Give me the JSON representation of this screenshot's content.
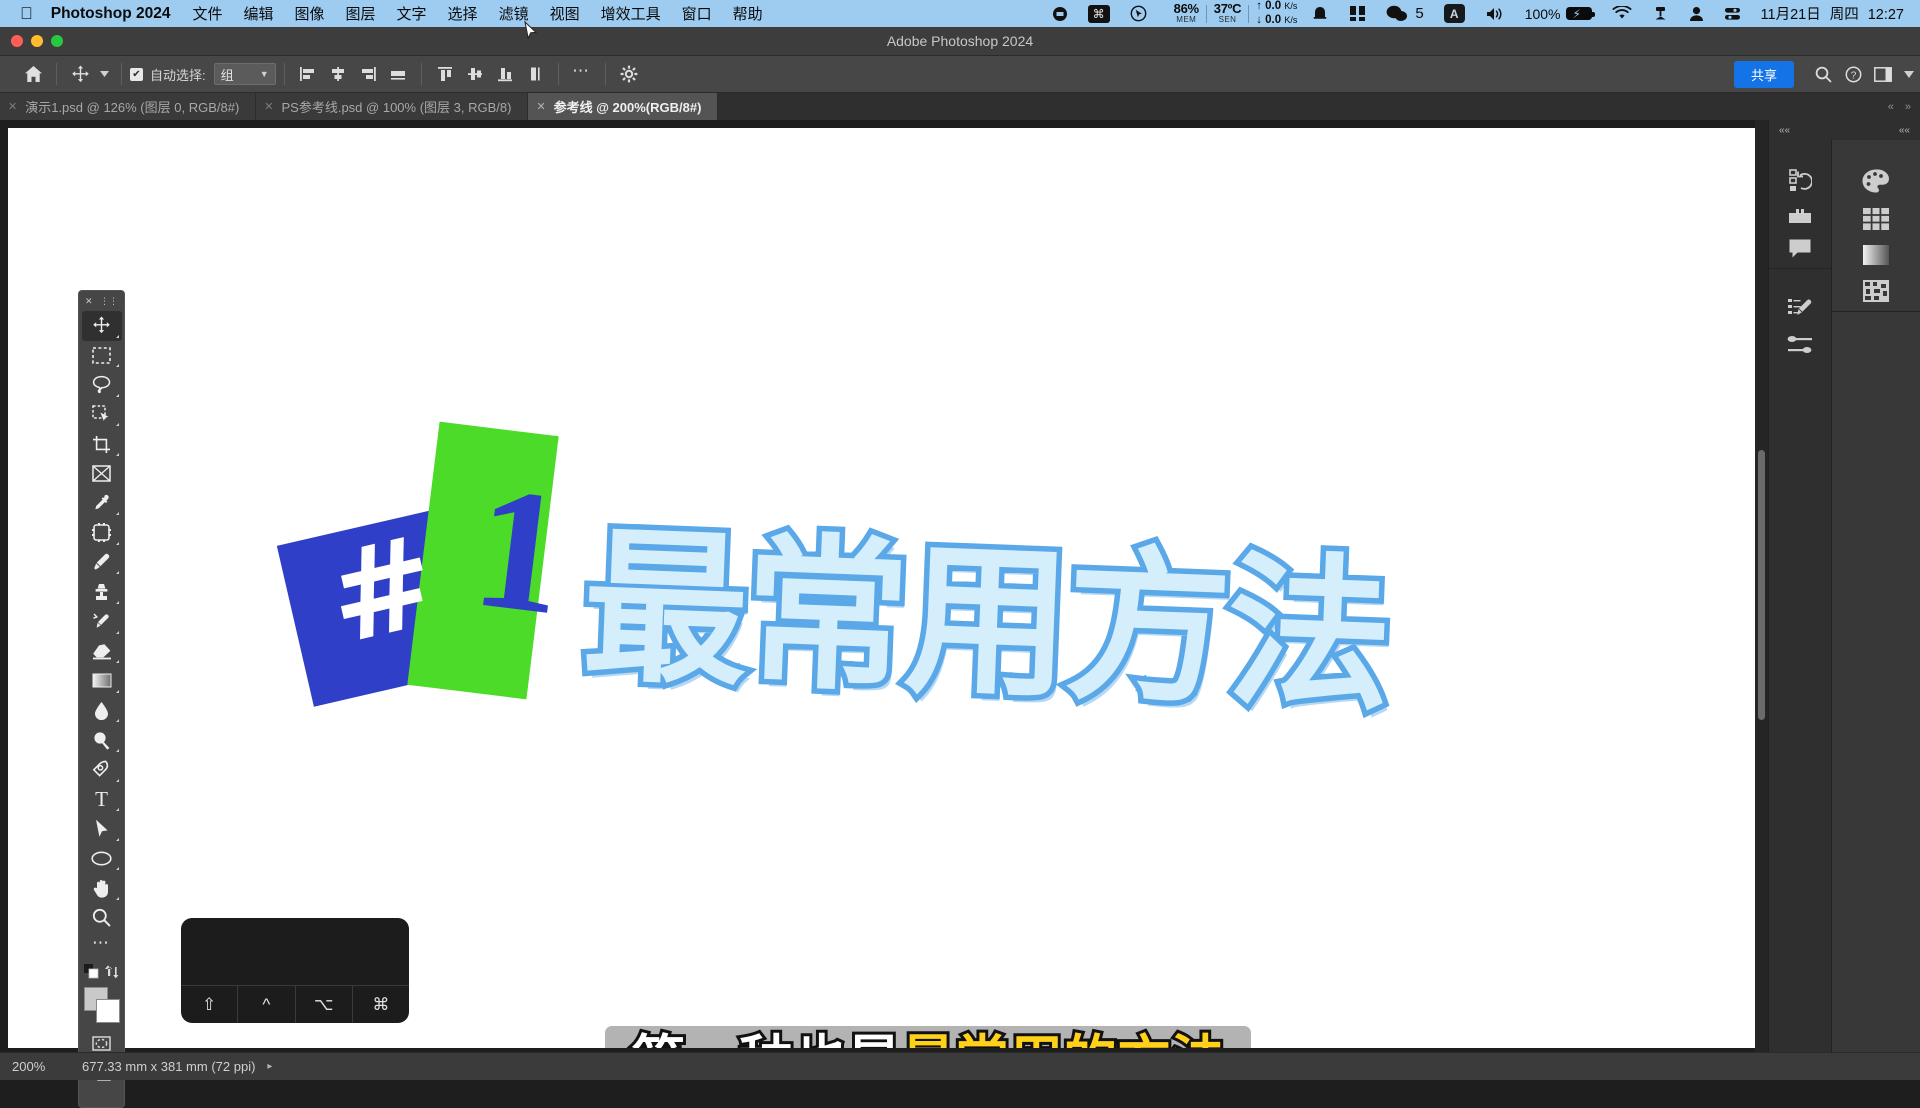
{
  "menubar": {
    "apple_icon": "apple-logo-icon",
    "app_name": "Photoshop 2024",
    "menus": [
      "文件",
      "编辑",
      "图像",
      "图层",
      "文字",
      "选择",
      "滤镜",
      "视图",
      "增效工具",
      "窗口",
      "帮助"
    ],
    "tray": {
      "record_icon": "record-dot-icon",
      "command_badge": "⌘",
      "cursor_icon": "cursor-circle-icon",
      "memory_value": "86%",
      "memory_label": "MEM",
      "temp_value": "37ºC",
      "temp_label": "SEN",
      "net_up": "0.0",
      "net_up_unit": "K/s",
      "net_down": "0.0",
      "net_down_unit": "K/s",
      "bell_icon": "bell-icon",
      "grid_icon": "grid-apps-icon",
      "wechat_icon": "wechat-icon",
      "wechat_count": "5",
      "input_method": "A",
      "volume_icon": "volume-icon",
      "battery_percent": "100%",
      "battery_icon": "battery-charging-icon",
      "wifi_icon": "wifi-icon",
      "screen_icon": "airplay-icon",
      "user_icon": "user-icon",
      "controlcenter_icon": "control-center-icon",
      "date": "11月21日",
      "weekday": "周四",
      "time": "12:27"
    }
  },
  "window": {
    "title": "Adobe Photoshop 2024",
    "traffic_colors": [
      "#ff5f57",
      "#febc2e",
      "#28c840"
    ]
  },
  "options_bar": {
    "home_icon": "home-icon",
    "tool_icon": "move-tool-icon",
    "auto_select_checked": "✔",
    "auto_select_label": "自动选择:",
    "auto_select_value": "组",
    "align_icons": [
      "align-left-icon",
      "align-center-h-icon",
      "align-right-icon",
      "distribute-h-icon",
      "align-top-icon",
      "align-middle-v-icon",
      "align-bottom-icon",
      "distribute-v-icon"
    ],
    "more_icon": "more-options-icon",
    "settings_icon": "gear-icon",
    "share_label": "共享",
    "search_icon": "search-icon",
    "help_icon": "help-icon",
    "workspace_icon": "workspace-layout-icon",
    "chevron_icon": "chevron-down-icon"
  },
  "tabs": [
    {
      "label": "演示1.psd @ 126% (图层 0, RGB/8#)",
      "active": false
    },
    {
      "label": "PS参考线.psd @ 100% (图层 3, RGB/8)",
      "active": false
    },
    {
      "label": "参考线 @ 200%(RGB/8#)",
      "active": true
    }
  ],
  "tab_controls": {
    "collapse_icon": "collapse-icon",
    "expand_icon": "expand-icon"
  },
  "toolbar": {
    "grip_close_icon": "close-icon",
    "grip_drag_icon": "drag-handle-icon",
    "tools": [
      {
        "name": "move-tool",
        "selected": true,
        "flyout": false
      },
      {
        "name": "rectangular-marquee-tool",
        "selected": false,
        "flyout": true
      },
      {
        "name": "lasso-tool",
        "selected": false,
        "flyout": true
      },
      {
        "name": "object-selection-tool",
        "selected": false,
        "flyout": true
      },
      {
        "name": "crop-tool",
        "selected": false,
        "flyout": true
      },
      {
        "name": "frame-tool",
        "selected": false,
        "flyout": false
      },
      {
        "name": "eyedropper-tool",
        "selected": false,
        "flyout": true
      },
      {
        "name": "spot-healing-brush-tool",
        "selected": false,
        "flyout": true
      },
      {
        "name": "brush-tool",
        "selected": false,
        "flyout": true
      },
      {
        "name": "clone-stamp-tool",
        "selected": false,
        "flyout": true
      },
      {
        "name": "history-brush-tool",
        "selected": false,
        "flyout": true
      },
      {
        "name": "eraser-tool",
        "selected": false,
        "flyout": true
      },
      {
        "name": "gradient-tool",
        "selected": false,
        "flyout": true
      },
      {
        "name": "blur-tool",
        "selected": false,
        "flyout": true
      },
      {
        "name": "dodge-tool",
        "selected": false,
        "flyout": true
      },
      {
        "name": "pen-tool",
        "selected": false,
        "flyout": true
      },
      {
        "name": "type-tool",
        "selected": false,
        "flyout": true
      },
      {
        "name": "path-selection-tool",
        "selected": false,
        "flyout": true
      },
      {
        "name": "ellipse-shape-tool",
        "selected": false,
        "flyout": true
      },
      {
        "name": "hand-tool",
        "selected": false,
        "flyout": true
      },
      {
        "name": "zoom-tool",
        "selected": false,
        "flyout": false
      }
    ],
    "more_tools_icon": "more-tools-icon",
    "edit_toolbar_icon": "edit-toolbar-icon",
    "swap_colors_icon": "swap-colors-icon",
    "foreground_color": "#c9c9c9",
    "background_color": "#ffffff",
    "quick_mask_icon": "quick-mask-icon",
    "screen_mode_icon": "screen-mode-icon"
  },
  "right_dock": {
    "groups": [
      {
        "icons": [
          "history-panel-icon",
          "libraries-panel-icon",
          "comments-panel-icon"
        ]
      },
      {
        "icons": [
          "brush-settings-panel-icon",
          "brush-presets-panel-icon"
        ]
      }
    ],
    "right_icons": [
      "color-panel-icon",
      "swatches-panel-icon",
      "gradients-panel-icon",
      "patterns-panel-icon"
    ],
    "collapse_icon": "double-chevron-icon"
  },
  "artwork": {
    "hash_symbol": "#",
    "number": "1",
    "headline": "最常用方法",
    "blue_card_color": "#2f3fc7",
    "green_card_color": "#4ddb2a",
    "headline_fill": "#d4eefb",
    "headline_stroke": "#5aa8e8"
  },
  "key_hud": {
    "keys": [
      "⇧",
      "^",
      "⌥",
      "⌘"
    ]
  },
  "subtitle": {
    "white_text": "第一种也是",
    "yellow_text": "最常用的方法",
    "background": "#b3b3b3",
    "yellow": "#ffd11a"
  },
  "status_bar": {
    "zoom": "200%",
    "dimensions": "677.33 mm x 381 mm (72 ppi)",
    "arrow_icon": "chevron-right-icon"
  }
}
